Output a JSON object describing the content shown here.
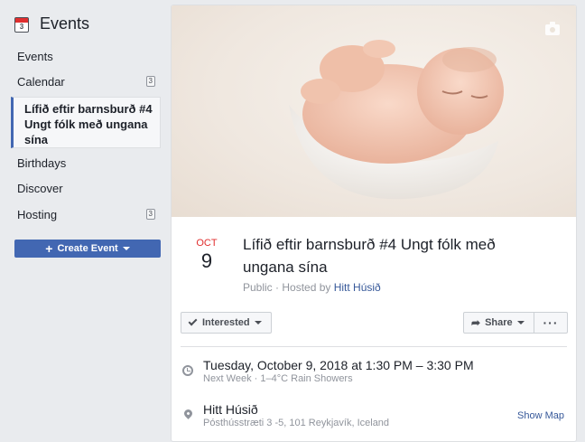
{
  "sidebar": {
    "title": "Events",
    "calendar_icon_number": "3",
    "items": [
      {
        "label": "Events"
      },
      {
        "label": "Calendar",
        "badge": "3"
      },
      {
        "label": "Lífið eftir barnsburð #4 Ungt fólk með ungana sína"
      },
      {
        "label": "Birthdays"
      },
      {
        "label": "Discover"
      },
      {
        "label": "Hosting",
        "badge": "3"
      }
    ],
    "create_button": "Create Event"
  },
  "event": {
    "month": "OCT",
    "day": "9",
    "title": "Lífið eftir barnsburð #4 Ungt fólk með ungana sína",
    "privacy": "Public",
    "hosted_by_prefix": " · Hosted by ",
    "host": "Hitt Húsið",
    "interested_label": "Interested",
    "share_label": "Share",
    "more_label": "···",
    "when_main": "Tuesday, October 9, 2018 at 1:30 PM – 3:30 PM",
    "when_sub": "Next Week · 1–4°C Rain Showers",
    "where_main": "Hitt Húsið",
    "where_sub": "Pósthússtræti 3 -5, 101 Reykjavík, Iceland",
    "show_map": "Show Map"
  },
  "icons": {
    "calendar": "calendar-icon",
    "camera": "camera-icon",
    "check": "check-icon",
    "share": "share-icon",
    "clock": "clock-icon",
    "pin": "location-pin-icon"
  },
  "colors": {
    "accent": "#4267b2",
    "link": "#365899",
    "date_red": "#e02f2f"
  }
}
